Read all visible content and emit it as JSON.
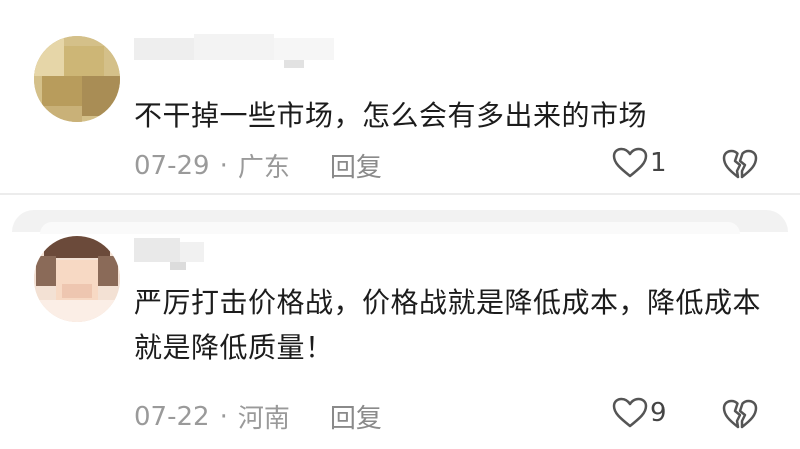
{
  "comments": [
    {
      "text": "不干掉一些市场，怎么会有多出来的市场",
      "date": "07-29",
      "separator": "·",
      "region": "广东",
      "reply_label": "回复",
      "like_count": "1"
    },
    {
      "text": "严厉打击价格战，价格战就是降低成本，降低成本就是降低质量！",
      "date": "07-22",
      "separator": "·",
      "region": "河南",
      "reply_label": "回复",
      "like_count": "9"
    }
  ],
  "icons": {
    "like": "heart-outline-icon",
    "dislike": "broken-heart-icon"
  },
  "colors": {
    "text": "#1c1c1c",
    "meta": "#9a9a9a",
    "icon": "#555555"
  }
}
